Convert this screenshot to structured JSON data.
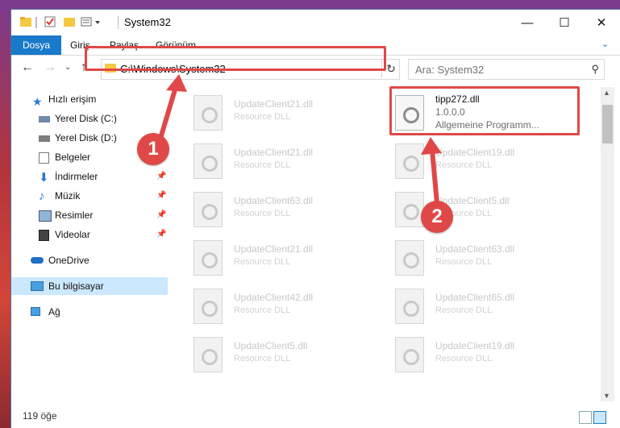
{
  "window": {
    "title": "System32",
    "controls": {
      "minimize": "—",
      "maximize": "☐",
      "close": "✕"
    }
  },
  "ribbon": {
    "tabs": [
      {
        "label": "Dosya"
      },
      {
        "label": "Giriş"
      },
      {
        "label": "Paylaş"
      },
      {
        "label": "Görünüm"
      }
    ]
  },
  "address": {
    "path": "C:\\Windows\\System32"
  },
  "search": {
    "placeholder": "Ara: System32"
  },
  "sidebar": {
    "items": [
      {
        "label": "Hızlı erişim",
        "icon": "star-icon"
      },
      {
        "label": "Yerel Disk (C:)",
        "icon": "drive-icon"
      },
      {
        "label": "Yerel Disk (D:)",
        "icon": "drive-icon"
      },
      {
        "label": "Belgeler",
        "icon": "documents-icon"
      },
      {
        "label": "İndirmeler",
        "icon": "download-icon"
      },
      {
        "label": "Müzik",
        "icon": "music-icon"
      },
      {
        "label": "Resimler",
        "icon": "pictures-icon"
      },
      {
        "label": "Videolar",
        "icon": "video-icon"
      },
      {
        "label": "OneDrive",
        "icon": "cloud-icon"
      },
      {
        "label": "Bu bilgisayar",
        "icon": "computer-icon"
      },
      {
        "label": "Ağ",
        "icon": "network-icon"
      }
    ]
  },
  "files": {
    "highlighted": {
      "name": "tipp272.dll",
      "version": "1.0.0.0",
      "company": "Allgemeine Programm..."
    },
    "left": [
      {
        "name": "UpdateClient21.dll",
        "type": "Resource DLL"
      },
      {
        "name": "UpdateClient21.dll",
        "type": "Resource DLL"
      },
      {
        "name": "UpdateClient63.dll",
        "type": "Resource DLL"
      },
      {
        "name": "UpdateClient21.dll",
        "type": "Resource DLL"
      },
      {
        "name": "UpdateClient42.dll",
        "type": "Resource DLL"
      },
      {
        "name": "UpdateClient5.dll",
        "type": "Resource DLL"
      }
    ],
    "right": [
      {
        "name": "UpdateClient19.dll",
        "type": "Resource DLL"
      },
      {
        "name": "UpdateClient5.dll",
        "type": "Resource DLL"
      },
      {
        "name": "UpdateClient63.dll",
        "type": "Resource DLL"
      },
      {
        "name": "UpdateClient65.dll",
        "type": "Resource DLL"
      },
      {
        "name": "UpdateClient19.dll",
        "type": "Resource DLL"
      }
    ]
  },
  "status": {
    "count": "119 öğe"
  },
  "callouts": {
    "one": "1",
    "two": "2"
  },
  "colors": {
    "accent": "#1979ca",
    "annotation": "#e04848"
  }
}
